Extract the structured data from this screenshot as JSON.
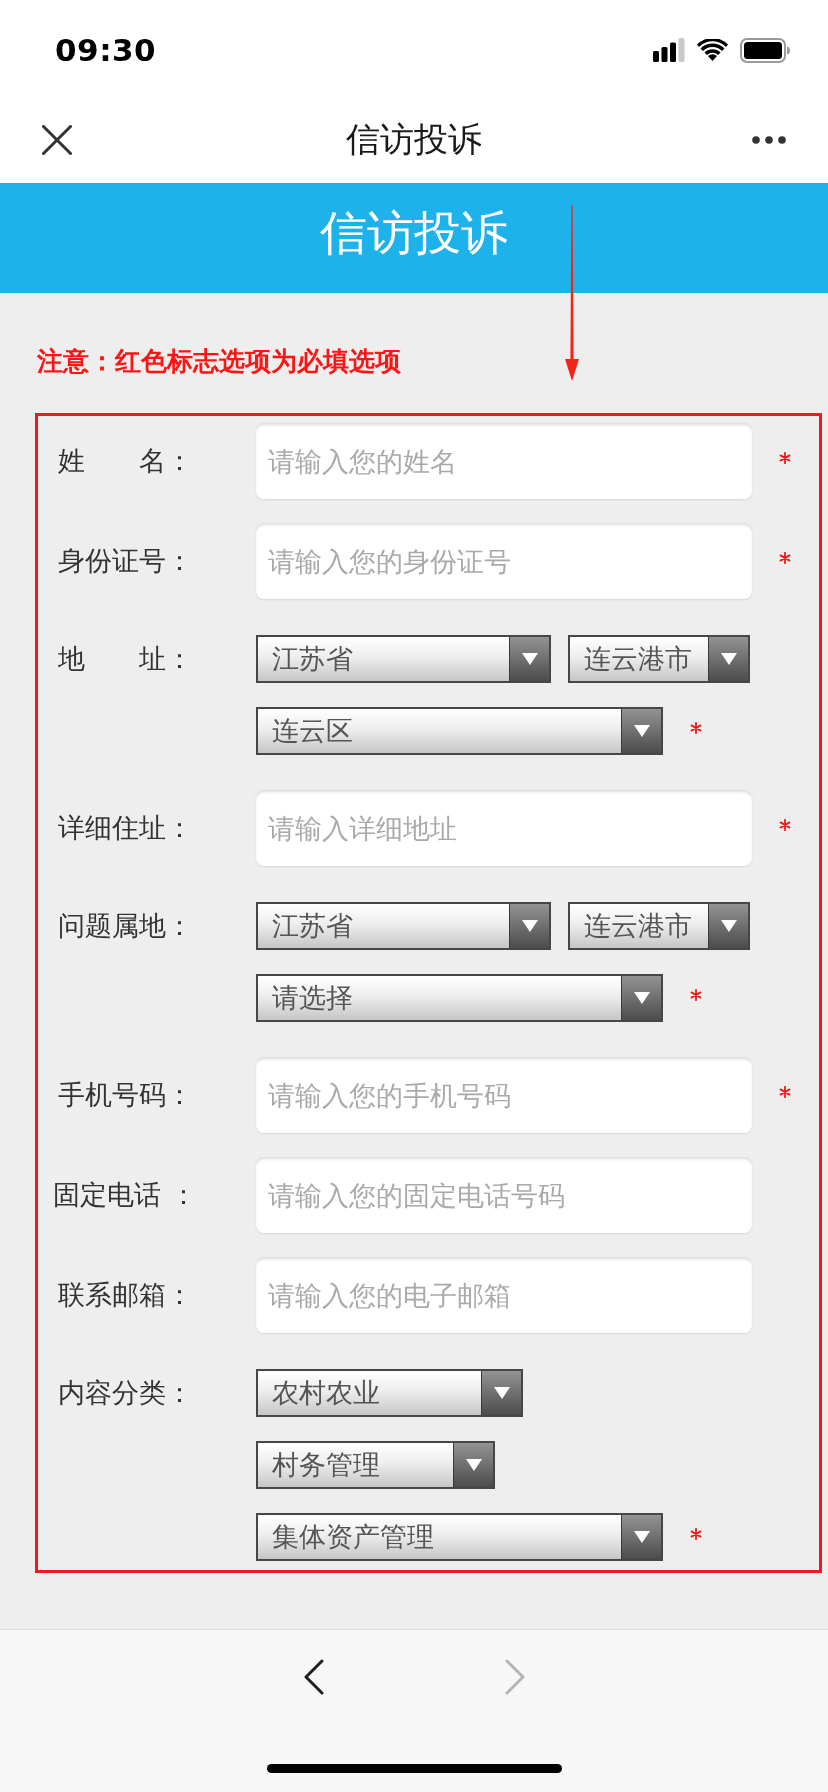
{
  "status_bar": {
    "time": "09:30"
  },
  "nav_bar": {
    "title": "信访投诉"
  },
  "banner": {
    "title": "信访投诉"
  },
  "notice": "注意：红色标志选项为必填选项",
  "form": {
    "rows": [
      {
        "kind": "input",
        "label": "姓　　名：",
        "placeholder": "请输入您的姓名",
        "required": true
      },
      {
        "kind": "input",
        "label": "身份证号：",
        "placeholder": "请输入您的身份证号",
        "required": true
      },
      {
        "kind": "select",
        "label": "地　　址：",
        "lines": [
          [
            "江苏省",
            "连云港市"
          ],
          [
            "连云区"
          ]
        ],
        "required": true
      },
      {
        "kind": "input",
        "label": "详细住址：",
        "placeholder": "请输入详细地址",
        "required": true
      },
      {
        "kind": "select",
        "label": "问题属地：",
        "lines": [
          [
            "江苏省",
            "连云港市"
          ],
          [
            "请选择"
          ]
        ],
        "required": true
      },
      {
        "kind": "input",
        "label": "手机号码：",
        "placeholder": "请输入您的手机号码",
        "required": true
      },
      {
        "kind": "input",
        "label": "固定电话 ：",
        "placeholder": "请输入您的固定电话号码",
        "required": false
      },
      {
        "kind": "input",
        "label": "联系邮箱：",
        "placeholder": "请输入您的电子邮箱",
        "required": false
      },
      {
        "kind": "select",
        "label": "内容分类：",
        "lines": [
          [
            "农村农业"
          ],
          [
            "村务管理"
          ],
          [
            "集体资产管理"
          ]
        ],
        "required": true
      }
    ]
  },
  "toolbar": {
    "back": {
      "disabled": false
    },
    "forward": {
      "disabled": true
    }
  }
}
